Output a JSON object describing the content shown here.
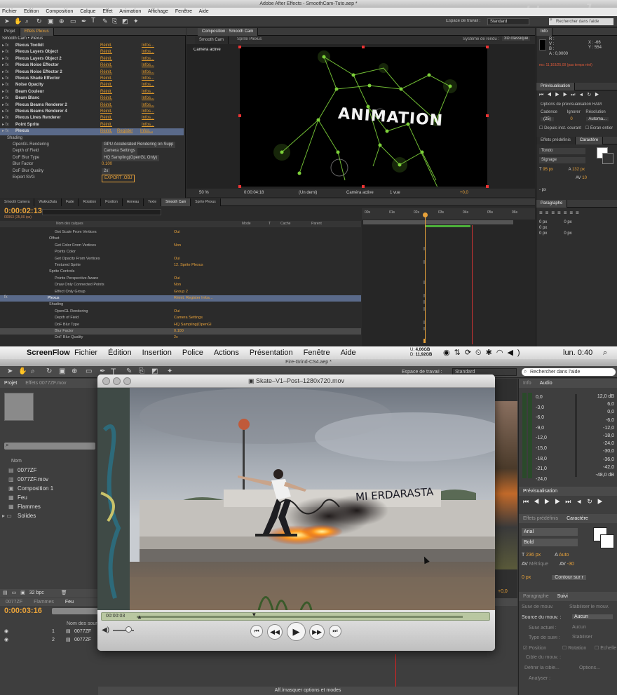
{
  "ae": {
    "window_title": "Adobe After Effects - SmoothCam-Tuto.aep *",
    "menu": [
      "Fichier",
      "Edition",
      "Composition",
      "Calque",
      "Effet",
      "Animation",
      "Affichage",
      "Fenêtre",
      "Aide"
    ],
    "watermark": "mattrunks",
    "workspace_label": "Espace de travail :",
    "workspace_value": "Standard",
    "search_help": "Rechercher dans l'aide",
    "project_tab": "Projet",
    "effects_tab": "Effets Plexus",
    "effects_path": "Smooth Cam • Plexus",
    "reset": "Réinit.",
    "infos": "Infos...",
    "register": "Register",
    "effects": [
      "Plexus Toolkit",
      "Plexus Layers Object",
      "Plexus Layers Object 2",
      "Plexus Noise Effector",
      "Plexus Noise Effector 2",
      "Plexus Shade Effector",
      "Noise Opacity",
      "Beam Couleur",
      "Beam Blanc",
      "Plexus Beams Renderer 2",
      "Plexus Beams Renderer 4",
      "Plexus Lines Renderer",
      "Point Sprite",
      "Plexus"
    ],
    "plexus_props": [
      {
        "name": "Shading",
        "value": ""
      },
      {
        "name": "OpenGL Rendering",
        "value": "GPU Accelerated Rendering on Supp"
      },
      {
        "name": "Depth of Field",
        "value": "Camera Settings"
      },
      {
        "name": "DoF Blur Type",
        "value": "HQ Sampling(OpenGL Only)"
      },
      {
        "name": "Blur Factor",
        "value": "0.100"
      },
      {
        "name": "DoF Blur Quality",
        "value": "2x"
      },
      {
        "name": "Export SVG",
        "value": "EXPORT .OBJ"
      }
    ],
    "comp_tab": "Composition : Smooth Cam",
    "comp_subtabs": [
      "Smooth Cam",
      "Sprite Plexus"
    ],
    "renderer": "Système de rendu :",
    "renderer_value": "3D classique",
    "camera_label": "Caméra active",
    "comp_text": "ANIMATION",
    "comp_footer": [
      "50 %",
      "0:00:04:18",
      "(Un demi)",
      "Caméra active",
      "1 vue",
      "+0,0"
    ],
    "info": {
      "tab": "Info",
      "r": "R :",
      "g": "V :",
      "b": "B :",
      "a": "A : 0,0000",
      "x": "X : -66",
      "y": "Y : 554",
      "timecode_line": "ms: 11,163/25,00 (pas temps réel)"
    },
    "preview": {
      "tab": "Prévisualisation",
      "ram_options": "Options de prévisualisation RAM",
      "cadence": "Cadence",
      "skip": "Ignorer",
      "resolution": "Résolution",
      "cadence_value": "(25)",
      "skip_value": "0",
      "resolution_value": "Automa...",
      "from_current": "Depuis inst. courant",
      "fullscreen": "Écran entier"
    },
    "presets_tab": "Effets prédéfinis",
    "character_tab": "Caractère",
    "char_font": "Tondo",
    "char_style": "Signage",
    "char_size": "95 px",
    "char_lead": "132 px",
    "char_track": "10",
    "char_px": "- px",
    "paragraph_tab": "Paragraphe",
    "para_px": [
      "0 px",
      "0 px",
      "0 px",
      "0 px",
      "0 px"
    ],
    "timeline": {
      "timecode": "0:00:02:13",
      "frames": "00063 (25,00 ips)",
      "tabs": [
        "Smooth Camera",
        "WakkaData",
        "Fade",
        "Rotation",
        "Position",
        "Anneau",
        "Texte",
        "Smooth Cam",
        "Sprite Plexus"
      ],
      "col_name": "Nom des calques",
      "col_mode": "Mode",
      "col_t": "T",
      "col_mask": "Cache",
      "col_parent": "Parent",
      "ruler": [
        "00s",
        "01s",
        "02s",
        "03s",
        "04s",
        "05s",
        "06s"
      ],
      "rows": [
        {
          "name": "Get Scale From Vertices",
          "value": "Oui"
        },
        {
          "name": "Offset",
          "value": ""
        },
        {
          "name": "Get Color From Vertices",
          "value": "Non"
        },
        {
          "name": "Points Color",
          "value": ""
        },
        {
          "name": "Get Opacity From Vertices",
          "value": "Oui"
        },
        {
          "name": "Textured Sprite",
          "value": "12. Sprite Plexus"
        },
        {
          "name": "Sprite Controls",
          "value": ""
        },
        {
          "name": "Points Perspective Aware",
          "value": "Oui"
        },
        {
          "name": "Draw Only Connected Points",
          "value": "Non"
        },
        {
          "name": "Effect Only Group",
          "value": "Group 2"
        },
        {
          "name": "Plexus",
          "value": "Réinit.   Register   Infos..."
        },
        {
          "name": "Shading",
          "value": ""
        },
        {
          "name": "OpenGL Rendering",
          "value": "Oui"
        },
        {
          "name": "Depth of Field",
          "value": "Camera Settings"
        },
        {
          "name": "DoF Blur Type",
          "value": "HQ Sampling(OpenGl"
        },
        {
          "name": "Blur Factor",
          "value": "0.100"
        },
        {
          "name": "DoF Blur Quality",
          "value": "2x"
        }
      ]
    }
  },
  "mac": {
    "app": "ScreenFlow",
    "menu": [
      "Fichier",
      "Édition",
      "Insertion",
      "Police",
      "Actions",
      "Présentation",
      "Fenêtre",
      "Aide"
    ],
    "mem_top": "4,06GB",
    "mem_bottom": "11,92GB",
    "disk_u": "U:",
    "disk_d": "D:",
    "clock": "lun. 0:40"
  },
  "ae2": {
    "window_title": "Fire-Grind-CS4.aep *",
    "workspace_label": "Espace de travail :",
    "workspace_value": "Standard",
    "search_help": "Rechercher dans l'aide",
    "project_tab": "Projet",
    "effects_tab": "Effets 0077ZF.mov",
    "col_name": "Nom",
    "items": [
      "0077ZF",
      "0077ZF.mov",
      "Composition 1",
      "Feu",
      "Flammes",
      "Solides"
    ],
    "bpc": "32 bpc",
    "info_tab": "Info",
    "audio_tab": "Audio",
    "audio_left": [
      "0,0",
      "-3,0",
      "-6,0",
      "-9,0",
      "-12,0",
      "-15,0",
      "-18,0",
      "-21,0",
      "-24,0"
    ],
    "audio_right": [
      "12,0 dB",
      "6,0",
      "0,0",
      "-6,0",
      "-12,0",
      "-18,0",
      "-24,0",
      "-30,0",
      "-36,0",
      "-42,0",
      "-48,0 dB"
    ],
    "preview_tab": "Prévisualisation",
    "presets_tab": "Effets prédéfinis",
    "character_tab": "Caractère",
    "char_font": "Arial",
    "char_style": "Bold",
    "char_size": "236 px",
    "char_lead": "Auto",
    "char_kern": "Métrique",
    "char_track": "-30",
    "char_px": "0 px",
    "char_stroke": "Contour sur r",
    "paragraph_tab": "Paragraphe",
    "tracker_tab": "Suivi",
    "tracker": {
      "track_camera": "Suivi de mouv.",
      "stabilize": "Stabiliser le mouv.",
      "source_label": "Source du mouv. :",
      "source_value": "Aucun",
      "current_track": "Suivi actuel :",
      "current_value": "Aucun",
      "track_type": "Type de suivi :",
      "track_type_value": "Stabiliser",
      "position": "Position",
      "rotation": "Rotation",
      "scale": "Échelle",
      "target": "Cible du mouv. :",
      "define_target": "Définir la cible...",
      "options": "Options...",
      "analyze": "Analyser :"
    },
    "timeline": {
      "tabs": [
        "0077ZF",
        "Flammes",
        "Feu"
      ],
      "timecode": "0:00:03:16",
      "col_name": "Nom des sources",
      "layers": [
        {
          "num": "1",
          "name": "0077ZF"
        },
        {
          "num": "2",
          "name": "0077ZF"
        }
      ],
      "footer": "Aff./masquer options et modes",
      "plus": "+0,0"
    }
  },
  "player": {
    "title": "Skate–V1–Post–1280x720.mov",
    "time": "00:00:03",
    "graffiti": "MI ERDARASTA",
    "progress": 0.36
  },
  "colors": {
    "ae_orange": "#e8a23a",
    "plexus_green": "#7dd13a",
    "player_bar": "#b9c7a1",
    "selection_blue": "#5a6a8a"
  }
}
